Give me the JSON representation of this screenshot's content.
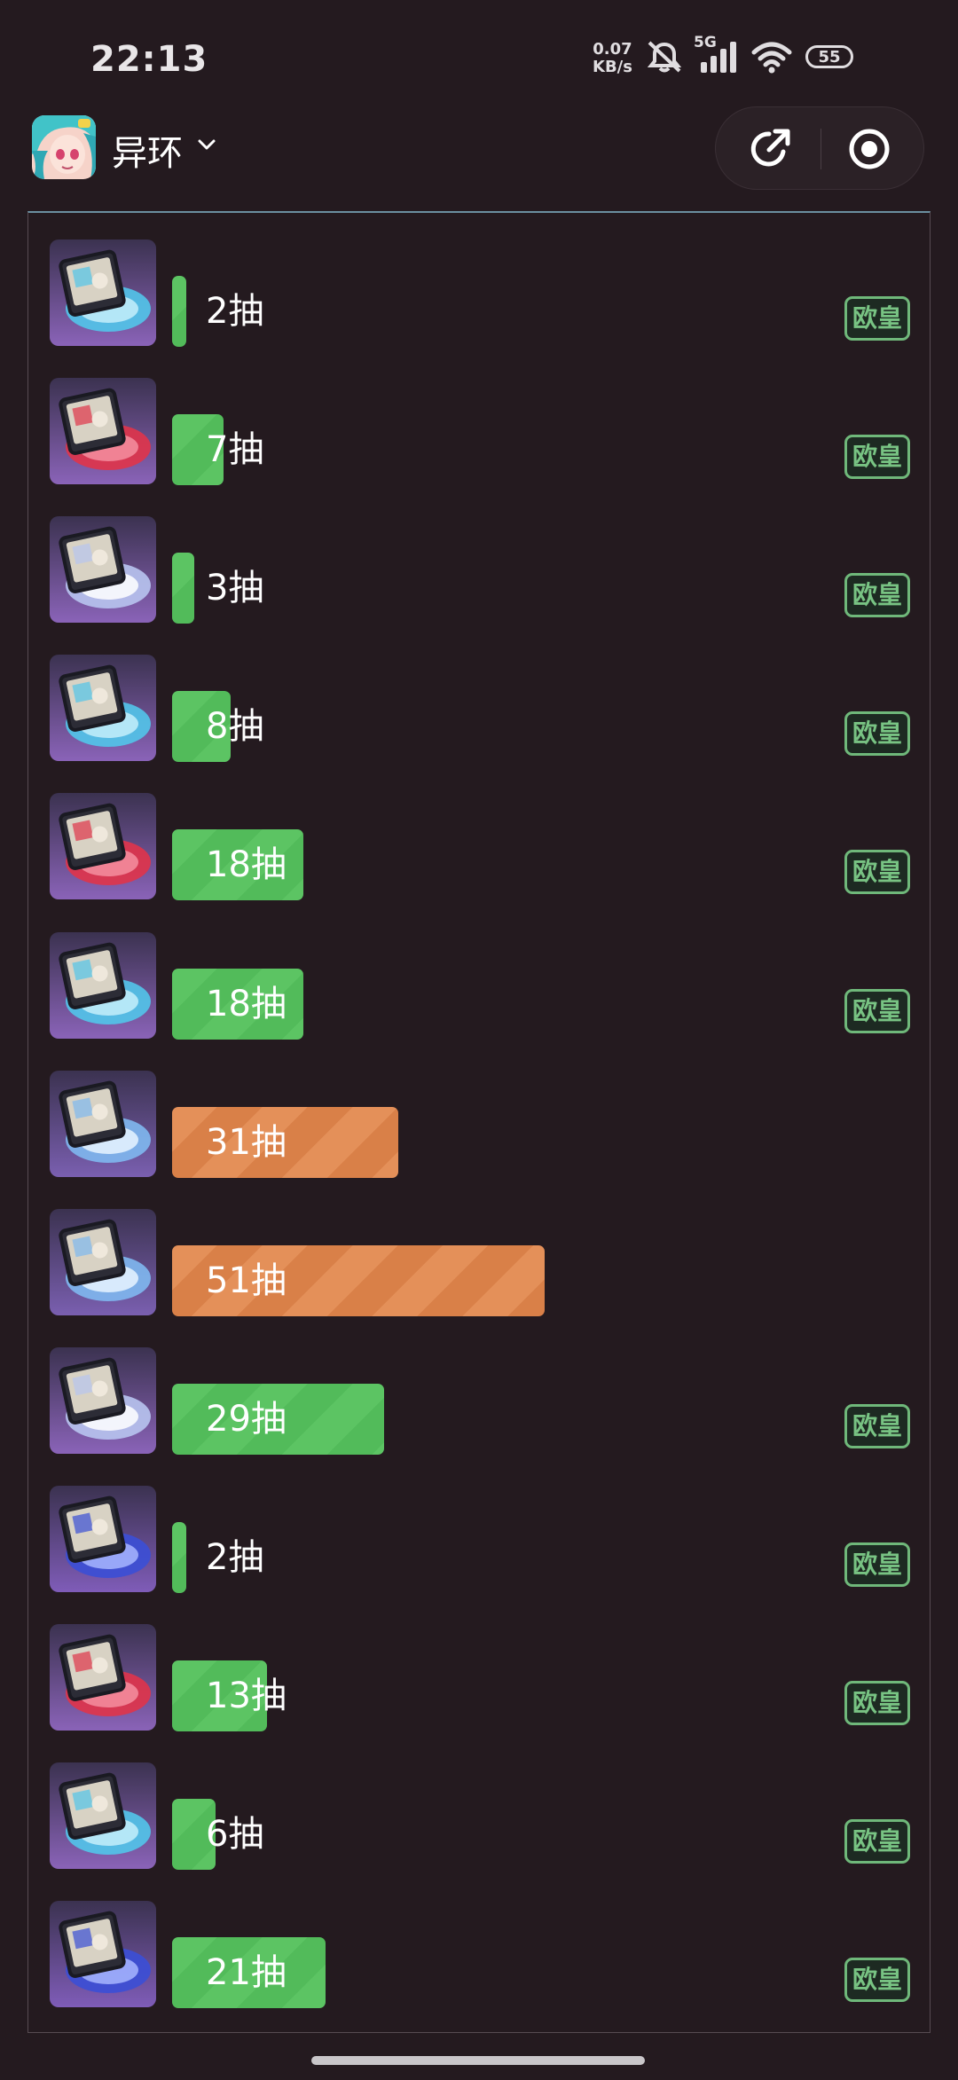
{
  "status_bar": {
    "time": "22:13",
    "net_speed_value": "0.07",
    "net_speed_unit": "KB/s",
    "network": "5G",
    "battery": "55"
  },
  "header": {
    "game_name": "异环",
    "share_icon": "share-arrow-icon",
    "capture_icon": "record-target-icon"
  },
  "records": [
    {
      "pulls": "2抽",
      "count": 2,
      "rating": "欧皇",
      "color": "green",
      "art": "blue-portal"
    },
    {
      "pulls": "7抽",
      "count": 7,
      "rating": "欧皇",
      "color": "green",
      "art": "red-portal"
    },
    {
      "pulls": "3抽",
      "count": 3,
      "rating": "欧皇",
      "color": "green",
      "art": "white-portal"
    },
    {
      "pulls": "8抽",
      "count": 8,
      "rating": "欧皇",
      "color": "green",
      "art": "blue-portal"
    },
    {
      "pulls": "18抽",
      "count": 18,
      "rating": "欧皇",
      "color": "green",
      "art": "red-portal"
    },
    {
      "pulls": "18抽",
      "count": 18,
      "rating": "欧皇",
      "color": "green",
      "art": "blue-portal"
    },
    {
      "pulls": "31抽",
      "count": 31,
      "rating": "",
      "color": "orange",
      "art": "sky-portal"
    },
    {
      "pulls": "51抽",
      "count": 51,
      "rating": "",
      "color": "orange",
      "art": "sky-portal"
    },
    {
      "pulls": "29抽",
      "count": 29,
      "rating": "欧皇",
      "color": "green",
      "art": "white-portal"
    },
    {
      "pulls": "2抽",
      "count": 2,
      "rating": "欧皇",
      "color": "green",
      "art": "indigo-portal"
    },
    {
      "pulls": "13抽",
      "count": 13,
      "rating": "欧皇",
      "color": "green",
      "art": "red-portal"
    },
    {
      "pulls": "6抽",
      "count": 6,
      "rating": "欧皇",
      "color": "green",
      "art": "blue-portal"
    },
    {
      "pulls": "21抽",
      "count": 21,
      "rating": "欧皇",
      "color": "green",
      "art": "indigo-portal"
    }
  ],
  "colors": {
    "background": "#241a1f",
    "good_bar": "#5cc463",
    "bad_bar": "#e49059",
    "tag_border": "#6fb87a"
  }
}
